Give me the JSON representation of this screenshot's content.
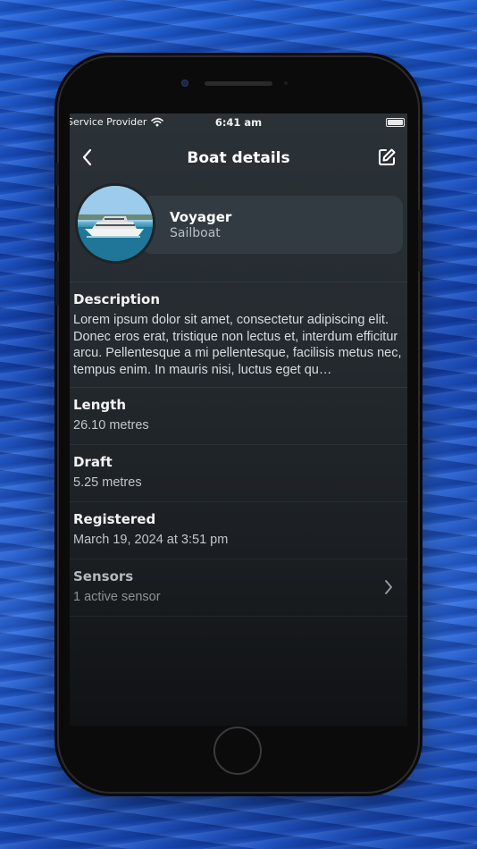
{
  "status_bar": {
    "carrier": "Service Provider",
    "time": "6:41 am"
  },
  "navbar": {
    "title": "Boat details"
  },
  "boat": {
    "name": "Voyager",
    "type": "Sailboat"
  },
  "description": {
    "label": "Description",
    "text": "Lorem ipsum dolor sit amet, consectetur adipiscing elit. Donec eros erat, tristique non lectus et, interdum efficitur arcu. Pellentesque a mi pellentesque, facilisis metus nec, tempus enim. In mauris nisi, luctus eget qu…"
  },
  "details": [
    {
      "label": "Length",
      "value": "26.10 metres"
    },
    {
      "label": "Draft",
      "value": "5.25 metres"
    },
    {
      "label": "Registered",
      "value": "March 19, 2024 at 3:51 pm"
    }
  ],
  "sensors": {
    "label": "Sensors",
    "value": "1 active sensor"
  },
  "icons": {
    "back": "chevron-left-icon",
    "edit": "edit-icon",
    "disclosure": "chevron-right-icon",
    "wifi": "wifi-icon",
    "battery": "battery-icon"
  },
  "colors": {
    "background_water": "#1f5fd6",
    "screen_top": "#2b3237",
    "card": "#323b42",
    "text_primary": "#ffffff",
    "text_secondary": "#b7bec4"
  }
}
